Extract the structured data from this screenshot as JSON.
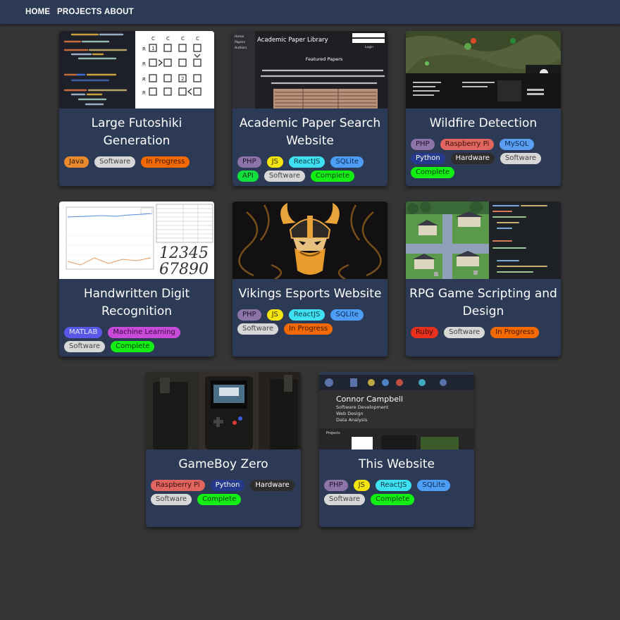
{
  "nav": {
    "home": "HOME",
    "projects": "PROJECTS",
    "about": "ABOUT"
  },
  "colors": {
    "page_bg": "#353535",
    "card_bg": "#2c3a55",
    "nav_bg": "#2c3a55"
  },
  "tag_colors": {
    "Java": {
      "bg": "#e8892e",
      "fg": "#2a1a05"
    },
    "Software": {
      "bg": "#d7d7d7",
      "fg": "#444444"
    },
    "In Progress": {
      "bg": "#f56a00",
      "fg": "#3a1600"
    },
    "PHP": {
      "bg": "#8c74a8",
      "fg": "#1f1430"
    },
    "JS": {
      "bg": "#f5e50c",
      "fg": "#3a3400"
    },
    "ReactJS": {
      "bg": "#3fe0f2",
      "fg": "#053c44"
    },
    "SQLite": {
      "bg": "#4d9df5",
      "fg": "#0d2a52"
    },
    "API": {
      "bg": "#11e03f",
      "fg": "#063512"
    },
    "Complete": {
      "bg": "#12ef12",
      "fg": "#074007"
    },
    "Raspberry Pi": {
      "bg": "#e0655f",
      "fg": "#3a0f0c"
    },
    "MySQL": {
      "bg": "#5a9ef2",
      "fg": "#0c2a52"
    },
    "Python": {
      "bg": "#253a8c",
      "fg": "#ffffff"
    },
    "Hardware": {
      "bg": "#2d2d2d",
      "fg": "#ffffff"
    },
    "MATLAB": {
      "bg": "#5858e8",
      "fg": "#e8e8ff"
    },
    "Machine Learning": {
      "bg": "#c84ad8",
      "fg": "#3a0842"
    },
    "Ruby": {
      "bg": "#e8301d",
      "fg": "#3a0a05"
    }
  },
  "projects": [
    {
      "title": "Large Futoshiki Generation",
      "thumb_icon": "code-puzzle-thumbnail",
      "tags": [
        "Java",
        "Software",
        "In Progress"
      ]
    },
    {
      "title": "Academic Paper Search Website",
      "thumb_icon": "paper-library-thumbnail",
      "tags": [
        "PHP",
        "JS",
        "ReactJS",
        "SQLite",
        "API",
        "Software",
        "Complete"
      ],
      "thumb_text": {
        "heading": "Academic Paper Library",
        "sub": "Featured Papers",
        "nav": [
          "Home",
          "Papers",
          "Authors"
        ],
        "login": "Login"
      }
    },
    {
      "title": "Wildfire Detection",
      "thumb_icon": "satellite-map-thumbnail",
      "tags": [
        "PHP",
        "Raspberry Pi",
        "MySQL",
        "Python",
        "Hardware",
        "Software",
        "Complete"
      ]
    },
    {
      "title": "Handwritten Digit Recognition",
      "thumb_icon": "digit-chart-thumbnail",
      "tags": [
        "MATLAB",
        "Machine Learning",
        "Software",
        "Complete"
      ],
      "thumb_text": {
        "digits1": "12345",
        "digits2": "67890"
      }
    },
    {
      "title": "Vikings Esports Website",
      "thumb_icon": "viking-logo-thumbnail",
      "tags": [
        "PHP",
        "JS",
        "ReactJS",
        "SQLite",
        "Software",
        "In Progress"
      ]
    },
    {
      "title": "RPG Game Scripting and Design",
      "thumb_icon": "rpg-map-thumbnail",
      "tags": [
        "Ruby",
        "Software",
        "In Progress"
      ]
    },
    {
      "title": "GameBoy Zero",
      "thumb_icon": "gameboy-photo-thumbnail",
      "tags": [
        "Raspberry Pi",
        "Python",
        "Hardware",
        "Software",
        "Complete"
      ]
    },
    {
      "title": "This Website",
      "thumb_icon": "portfolio-site-thumbnail",
      "tags": [
        "PHP",
        "JS",
        "ReactJS",
        "SQLite",
        "Software",
        "Complete"
      ],
      "thumb_text": {
        "name": "Connor Campbell",
        "lines": [
          "Software Development",
          "Web Design",
          "Data Analysis"
        ],
        "section": "Projects"
      }
    }
  ]
}
